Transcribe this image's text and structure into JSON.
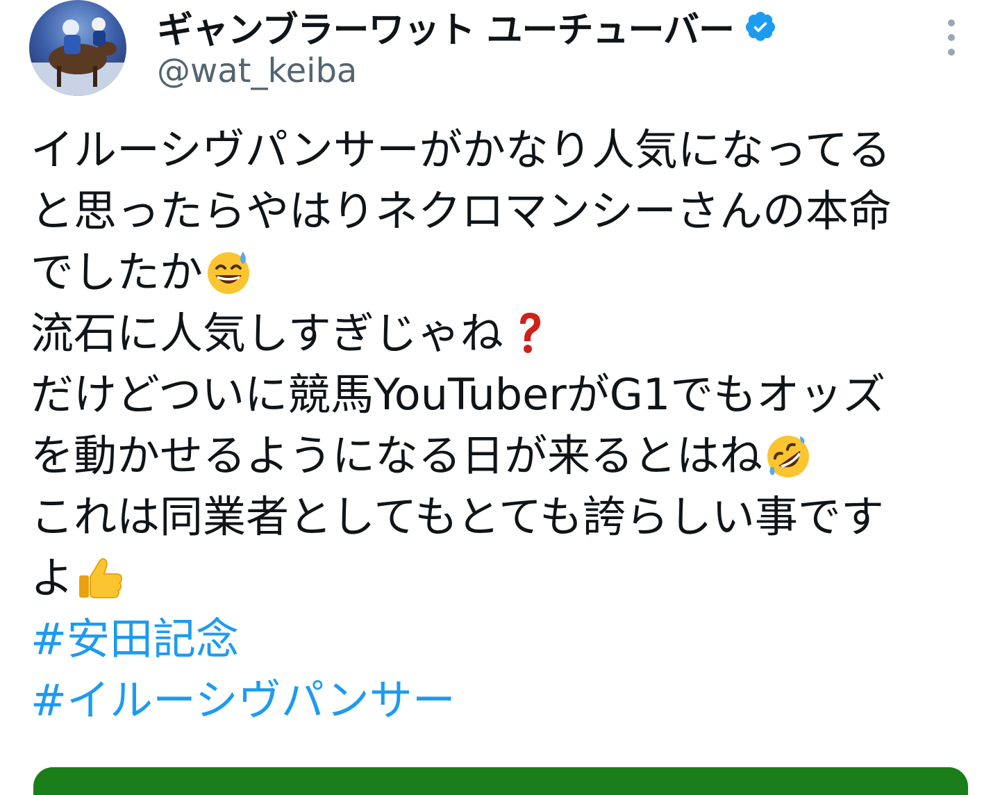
{
  "author": {
    "display_name": "ギャンブラーワット ユーチューバー",
    "handle": "@wat_keiba",
    "verified": true,
    "verified_icon": "verified-badge-icon",
    "avatar_icon": "horse-racing-avatar"
  },
  "menu": {
    "more_icon": "more-vertical-icon"
  },
  "tweet": {
    "lines": [
      "イルーシヴパンサーがかなり人気になってる",
      "と思ったらやはりネクロマンシーさんの本命",
      "でしたか",
      "流石に人気しすぎじゃね",
      "だけどついに競馬YouTuberがG1でもオッズ",
      "を動かせるようになる日が来るとはね",
      "これは同業者としてもとても誇らしい事です",
      "よ"
    ],
    "emojis": {
      "line3": "grinning-sweat-emoji",
      "line4": "red-question-mark-emoji",
      "line6": "rolling-on-floor-laughing-emoji",
      "line8": "thumbs-up-emoji"
    },
    "hashtags": [
      "#安田記念",
      "#イルーシヴパンサー"
    ]
  },
  "colors": {
    "text": "#0f1419",
    "secondary": "#536471",
    "link": "#1d9bf0",
    "verified": "#1d9bf0",
    "card_edge": "#1a7f1a"
  }
}
